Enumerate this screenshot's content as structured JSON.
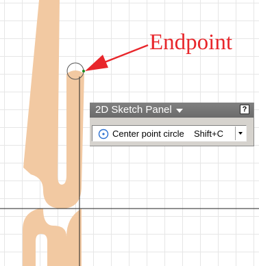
{
  "callout": {
    "label": "Endpoint",
    "color": "#e8262b"
  },
  "sketch": {
    "profile_fill": "#f2c9a2",
    "axis_color": "#222222",
    "grid_color": "#e6e6e6",
    "endpoint_marker": "circle-outline",
    "endpoint_glyph_color": "#1e8a1e"
  },
  "panel": {
    "title": "2D Sketch Panel",
    "help_icon": "help-question-icon",
    "help_glyph": "?",
    "tool": {
      "icon": "center-point-circle-icon",
      "label": "Center point circle",
      "shortcut": "Shift+C"
    }
  }
}
